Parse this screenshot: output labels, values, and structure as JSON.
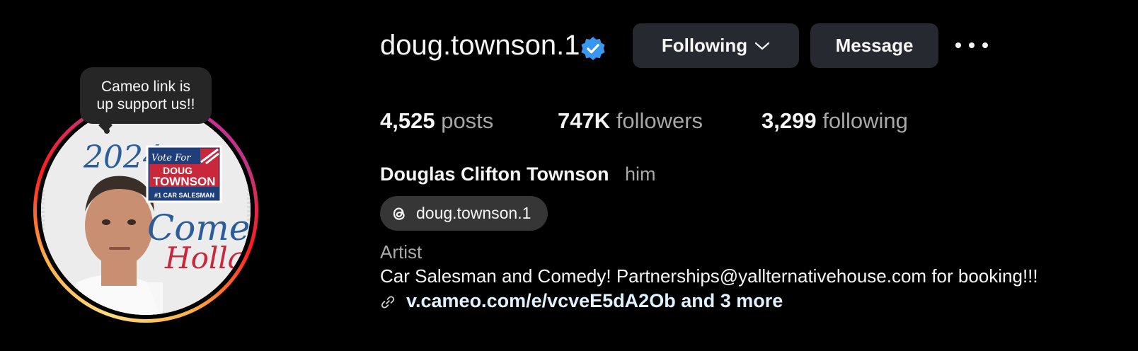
{
  "tooltip": {
    "line1": "Cameo link is",
    "line2": "up support us!!"
  },
  "avatar": {
    "year": "2024",
    "vote_for": "Vote For",
    "name_line1": "DOUG",
    "name_line2": "TOWNSON",
    "subtitle": "#1 CAR SALESMAN",
    "slogan_line1": "Come",
    "slogan_line2": "Holla"
  },
  "header": {
    "username": "doug.townson.1",
    "verified_icon": "verified-badge-icon",
    "following_label": "Following",
    "message_label": "Message"
  },
  "stats": {
    "posts": {
      "value": "4,525",
      "label": "posts"
    },
    "followers": {
      "value": "747K",
      "label": "followers"
    },
    "following": {
      "value": "3,299",
      "label": "following"
    }
  },
  "profile": {
    "full_name": "Douglas Clifton Townson",
    "pronouns": "him",
    "threads_handle": "doug.townson.1",
    "category": "Artist",
    "bio": "Car Salesman and Comedy! Partnerships@yallternativehouse.com for booking!!!",
    "link_text": "v.cameo.com/e/vcveE5dA2Ob and 3 more"
  },
  "colors": {
    "background": "#000000",
    "button_bg": "#262a30",
    "verified_blue": "#3897f0",
    "secondary_text": "#a8a8a8",
    "link_text": "#e0f1ff"
  }
}
